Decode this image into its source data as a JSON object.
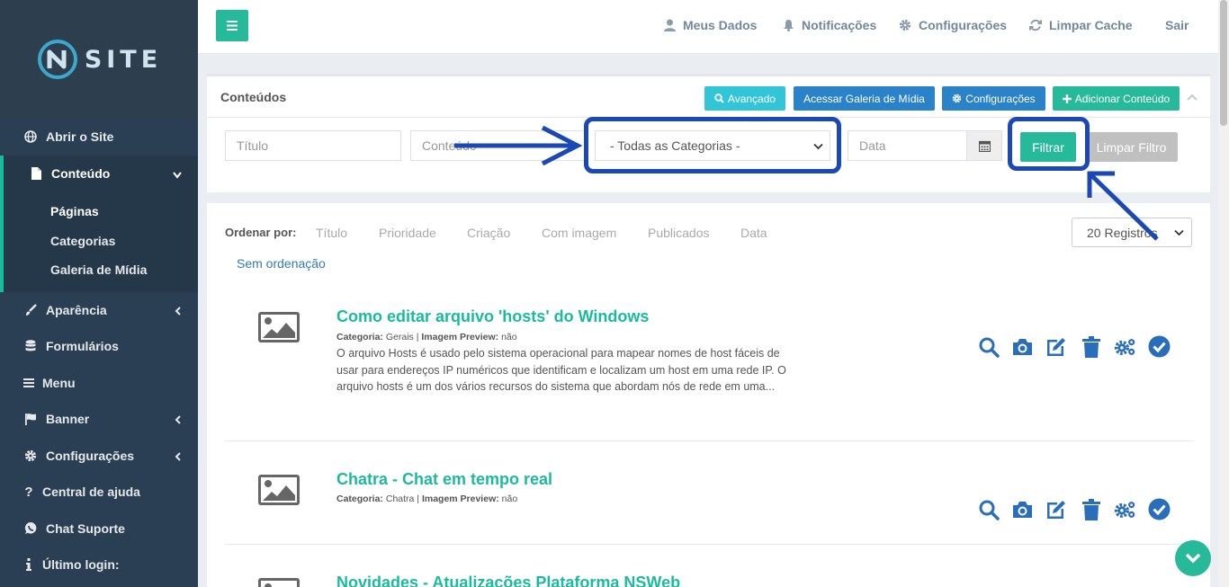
{
  "brand": {
    "logo_text": "SITE"
  },
  "topbar": {
    "links": [
      "Meus Dados",
      "Notificações",
      "Configurações",
      "Limpar Cache",
      "Sair"
    ]
  },
  "sidebar": {
    "items": [
      {
        "label": "Abrir o Site",
        "icon": "globe-icon"
      },
      {
        "label": "Conteúdo",
        "icon": "file-icon"
      },
      {
        "label": "Aparência",
        "icon": "brush-icon"
      },
      {
        "label": "Formulários",
        "icon": "database-icon"
      },
      {
        "label": "Menu",
        "icon": "bars-icon"
      },
      {
        "label": "Banner",
        "icon": "flag-icon"
      },
      {
        "label": "Configurações",
        "icon": "gear-icon"
      },
      {
        "label": "Central de ajuda",
        "icon": "question-icon"
      },
      {
        "label": "Chat Suporte",
        "icon": "whatsapp-icon"
      },
      {
        "label": "Último login:",
        "icon": "info-icon"
      }
    ],
    "subitems": [
      "Páginas",
      "Categorias",
      "Galeria de Mídia"
    ]
  },
  "content_panel": {
    "title": "Conteúdos",
    "buttons": {
      "advanced": "Avançado",
      "gallery": "Acessar Galeria de Mídia",
      "settings": "Configurações",
      "add": "Adicionar Conteúdo"
    },
    "filters": {
      "title_placeholder": "Título",
      "content_placeholder": "Conteúdo",
      "category_selected": "- Todas as Categorias -",
      "date_placeholder": "Data",
      "filter_button": "Filtrar",
      "clear_button": "Limpar Filtro"
    }
  },
  "list": {
    "sort_label": "Ordenar por:",
    "sort_options": [
      "Título",
      "Prioridade",
      "Criação",
      "Com imagem",
      "Publicados",
      "Data"
    ],
    "no_order": "Sem ordenação",
    "records_selected": "20 Registros",
    "meta_labels": {
      "category": "Categoria:",
      "preview": "Imagem Preview:"
    },
    "items": [
      {
        "title": "Como editar arquivo 'hosts' do Windows",
        "category": "Gerais",
        "preview": "não",
        "description": "O arquivo Hosts é usado pelo sistema operacional para mapear nomes de host fáceis de usar para endereços IP numéricos que identificam e localizam um host em uma rede IP. O arquivo hosts é um dos vários recursos do sistema que abordam nós de rede em uma..."
      },
      {
        "title": "Chatra - Chat em tempo real",
        "category": "Chatra",
        "preview": "não",
        "description": ""
      },
      {
        "title": "Novidades - Atualizações Plataforma NSWeb",
        "category": "",
        "preview": "",
        "description": ""
      }
    ]
  },
  "colors": {
    "sidebar_bg": "#2a3f54",
    "accent_green": "#26b99a",
    "title_green": "#1abb9c",
    "action_blue": "#2a6ebb",
    "annotation_blue": "#1a49b5"
  }
}
